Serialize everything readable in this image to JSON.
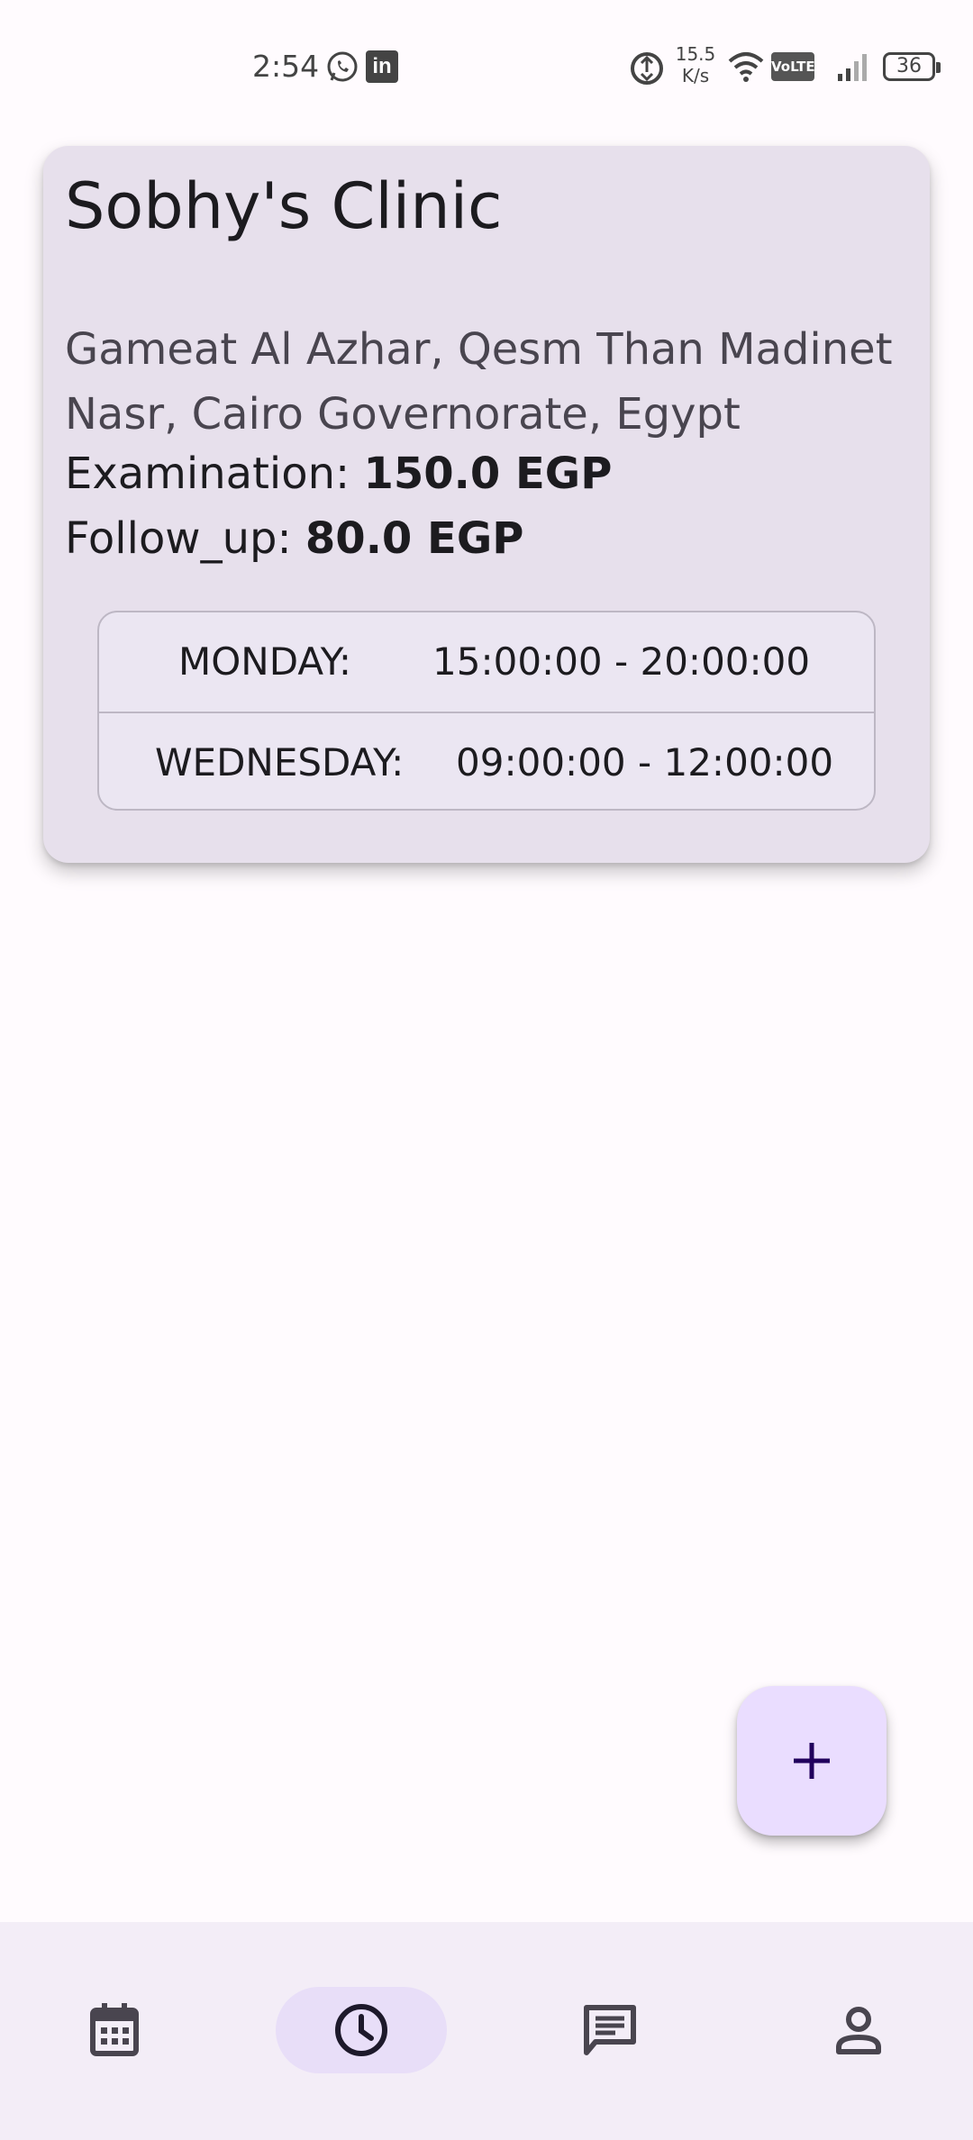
{
  "status_bar": {
    "time": "2:54",
    "net_speed_value": "15.5",
    "net_speed_unit": "K/s",
    "volte": "VoLTE",
    "battery": "36",
    "icons": [
      "whatsapp-icon",
      "linkedin-icon",
      "data-saver-icon",
      "wifi-icon",
      "volte-icon",
      "signal-icon",
      "battery-icon"
    ]
  },
  "clinic": {
    "name": "Sobhy's Clinic",
    "address": "Gameat Al Azhar, Qesm Than Madinet Nasr, Cairo Governorate, Egypt",
    "examination_label": "Examination:",
    "examination_value": "150.0 EGP",
    "followup_label": "Follow_up:",
    "followup_value": "80.0 EGP",
    "schedule": [
      {
        "day": "MONDAY:",
        "time": "15:00:00 - 20:00:00"
      },
      {
        "day": "WEDNESDAY:",
        "time": "09:00:00 - 12:00:00"
      }
    ]
  },
  "fab": {
    "icon": "add-icon"
  },
  "bottom_nav": {
    "items": [
      {
        "icon": "calendar-icon",
        "selected": false
      },
      {
        "icon": "clock-icon",
        "selected": true
      },
      {
        "icon": "message-icon",
        "selected": false
      },
      {
        "icon": "person-icon",
        "selected": false
      }
    ]
  },
  "colors": {
    "background": "#fffbfe",
    "card": "#e7e0ec",
    "fab": "#eaddff",
    "nav_bar": "#f3edf7",
    "nav_selected": "#e8def8",
    "icon": "#49454f"
  }
}
